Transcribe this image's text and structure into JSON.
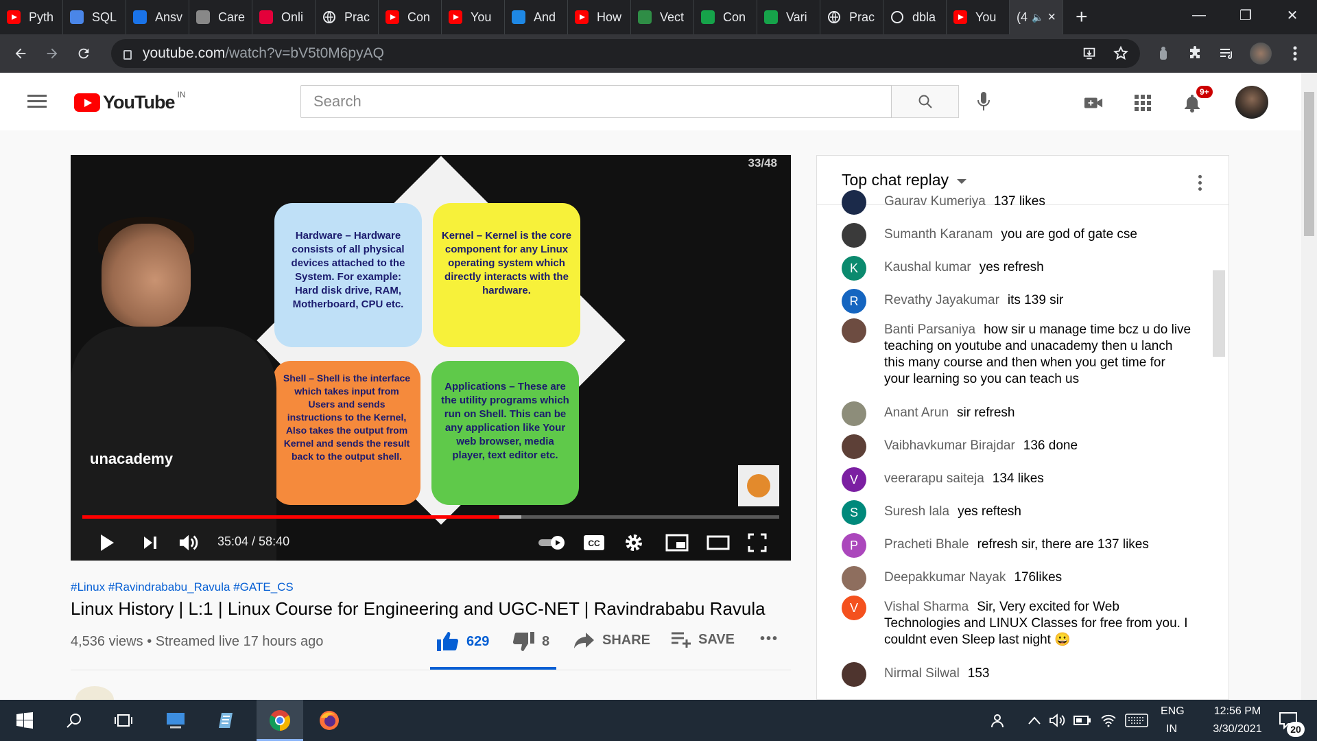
{
  "browser": {
    "tabs": [
      {
        "label": "Pyth",
        "favicon": "yt",
        "color": "#ff0000"
      },
      {
        "label": "SQL",
        "favicon": "doc",
        "color": "#4a86e8"
      },
      {
        "label": "Ansv",
        "favicon": "blue-circle",
        "color": "#1a73e8"
      },
      {
        "label": "Care",
        "favicon": "amp",
        "color": "#888888"
      },
      {
        "label": "Onli",
        "favicon": "u",
        "color": "#e4003a"
      },
      {
        "label": "Prac",
        "favicon": "globe",
        "color": "#e8eaed"
      },
      {
        "label": "Con",
        "favicon": "yt",
        "color": "#ff0000"
      },
      {
        "label": "You",
        "favicon": "yt",
        "color": "#ff0000"
      },
      {
        "label": "And",
        "favicon": "play",
        "color": "#1e88e5"
      },
      {
        "label": "How",
        "favicon": "yt",
        "color": "#ff0000"
      },
      {
        "label": "Vect",
        "favicon": "gfg",
        "color": "#2f8d46"
      },
      {
        "label": "Con",
        "favicon": "hi",
        "color": "#16a34a"
      },
      {
        "label": "Vari",
        "favicon": "hi",
        "color": "#16a34a"
      },
      {
        "label": "Prac",
        "favicon": "globe",
        "color": "#e8eaed"
      },
      {
        "label": "dbla",
        "favicon": "github",
        "color": "#e8eaed"
      },
      {
        "label": "You",
        "favicon": "yt",
        "color": "#ff0000"
      }
    ],
    "active_tab": {
      "label": "(4",
      "close": "×"
    },
    "new_tab": "+",
    "window_controls": {
      "minimize": "—",
      "restore": "❐",
      "close": "✕"
    },
    "url_domain": "youtube.com",
    "url_path": "/watch?v=bV5t0M6pyAQ"
  },
  "youtube": {
    "logo_text": "YouTube",
    "country": "IN",
    "search_placeholder": "Search",
    "notification_badge": "9+"
  },
  "player": {
    "slide_counter": "33/48",
    "presenter_brand": "unacademy",
    "cards": {
      "hardware": "Hardware – Hardware consists of all physical devices attached to the System. For example: Hard disk drive, RAM, Motherboard, CPU etc.",
      "kernel": "Kernel – Kernel is the core component for any Linux operating system which directly interacts with the hardware.",
      "shell": "Shell – Shell is the interface which takes input from Users and sends instructions to the Kernel, Also takes the output from Kernel and sends the result back to the output shell.",
      "applications": "Applications – These are the utility programs which run on Shell. This can be any application like Your web browser, media player, text editor etc."
    },
    "time_current": "35:04",
    "time_total": "58:40",
    "timecode": "35:04 / 58:40",
    "progress_played": 0.598,
    "cc_label": "CC"
  },
  "video": {
    "hashtags": "#Linux #Ravindrababu_Ravula #GATE_CS",
    "title": "Linux History | L:1 | Linux Course for Engineering and UGC-NET | Ravindrababu Ravula",
    "views": "4,536 views",
    "separator": "•",
    "streamed": "Streamed live 17 hours ago",
    "likes": "629",
    "dislikes": "8",
    "share": "SHARE",
    "save": "SAVE",
    "more": "•••"
  },
  "chat": {
    "title": "Top chat replay",
    "messages": [
      {
        "name": "Gaurav Kumeriya",
        "text": "137 likes",
        "avatar": "",
        "avatar_color": "#1b2a4a"
      },
      {
        "name": "Sumanth Karanam",
        "text": "you are god of gate cse",
        "avatar": "",
        "avatar_color": "#3a3a3a"
      },
      {
        "name": "Kaushal kumar",
        "text": "yes refresh",
        "avatar": "K",
        "avatar_color": "#0b8a6e"
      },
      {
        "name": "Revathy Jayakumar",
        "text": "its 139 sir",
        "avatar": "R",
        "avatar_color": "#1565c0"
      },
      {
        "name": "Banti Parsaniya",
        "text": "how sir u manage time bcz u do live teaching on youtube and unacademy then u lanch this many course and then when you get time for your learning so you can teach us",
        "avatar": "",
        "avatar_color": "#6d4c41"
      },
      {
        "name": "Anant Arun",
        "text": "sir refresh",
        "avatar": "",
        "avatar_color": "#8d8d7a"
      },
      {
        "name": "Vaibhavkumar Birajdar",
        "text": "136 done",
        "avatar": "",
        "avatar_color": "#5d4037"
      },
      {
        "name": "veerarapu saiteja",
        "text": "134 likes",
        "avatar": "V",
        "avatar_color": "#7b1fa2"
      },
      {
        "name": "Suresh lala",
        "text": "yes reftesh",
        "avatar": "S",
        "avatar_color": "#00897b"
      },
      {
        "name": "Pracheti Bhale",
        "text": "refresh sir, there are 137 likes",
        "avatar": "P",
        "avatar_color": "#ab47bc"
      },
      {
        "name": "Deepakkumar Nayak",
        "text": "176likes",
        "avatar": "",
        "avatar_color": "#8e6e5e"
      },
      {
        "name": "Vishal Sharma",
        "text": "Sir, Very excited for Web Technologies and LINUX Classes for free from you. I couldnt even Sleep last night 😀",
        "avatar": "V",
        "avatar_color": "#f4511e"
      },
      {
        "name": "Nirmal Silwal",
        "text": "153",
        "avatar": "",
        "avatar_color": "#4e342e"
      }
    ]
  },
  "taskbar": {
    "language": "ENG",
    "region": "IN",
    "time": "12:56 PM",
    "date": "3/30/2021",
    "notifications": "20"
  }
}
